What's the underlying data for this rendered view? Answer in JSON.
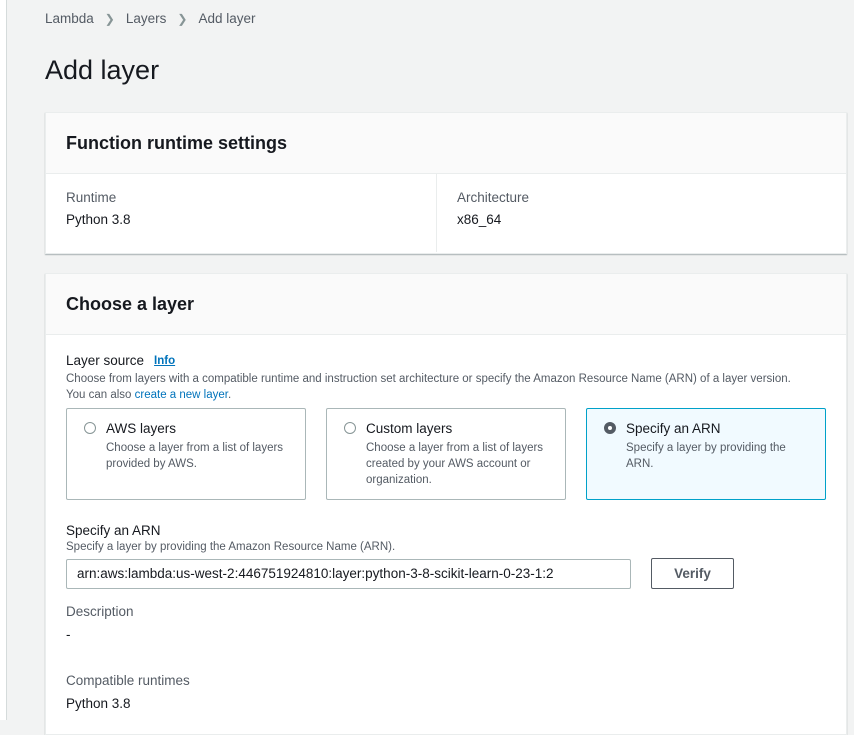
{
  "breadcrumb": {
    "items": [
      "Lambda",
      "Layers"
    ],
    "current": "Add layer"
  },
  "page": {
    "title": "Add layer"
  },
  "runtime_settings": {
    "title": "Function runtime settings",
    "runtime_label": "Runtime",
    "runtime_value": "Python 3.8",
    "architecture_label": "Architecture",
    "architecture_value": "x86_64"
  },
  "choose_layer": {
    "title": "Choose a layer",
    "source_label": "Layer source",
    "info_link": "Info",
    "source_desc_1": "Choose from layers with a compatible runtime and instruction set architecture or specify the Amazon Resource Name (ARN) of a layer version. You can also ",
    "create_link": "create a new layer",
    "source_desc_2": ".",
    "options": [
      {
        "title": "AWS layers",
        "desc": "Choose a layer from a list of layers provided by AWS.",
        "selected": false
      },
      {
        "title": "Custom layers",
        "desc": "Choose a layer from a list of layers created by your AWS account or organization.",
        "selected": false
      },
      {
        "title": "Specify an ARN",
        "desc": "Specify a layer by providing the ARN.",
        "selected": true
      }
    ],
    "arn_label": "Specify an ARN",
    "arn_desc": "Specify a layer by providing the Amazon Resource Name (ARN).",
    "arn_value": "arn:aws:lambda:us-west-2:446751924810:layer:python-3-8-scikit-learn-0-23-1:2",
    "verify_label": "Verify",
    "description_label": "Description",
    "description_value": "-",
    "compatible_runtimes_label": "Compatible runtimes",
    "compatible_runtimes_value": "Python 3.8"
  },
  "colors": {
    "accent": "#0073bb",
    "selected_bg": "#f1faff",
    "selected_border": "#00a1c9"
  }
}
